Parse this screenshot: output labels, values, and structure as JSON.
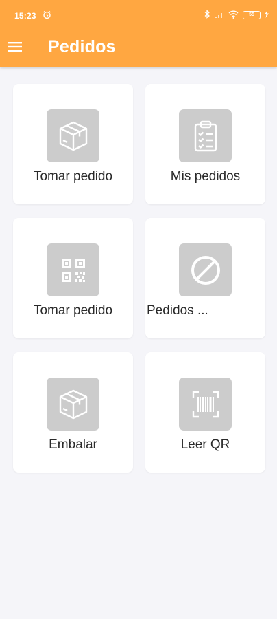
{
  "status_bar": {
    "time": "15:23",
    "battery": "55"
  },
  "header": {
    "title": "Pedidos",
    "background": "#ffa741"
  },
  "cards": [
    {
      "label": "Tomar pedido",
      "icon": "box-icon"
    },
    {
      "label": "Mis pedidos",
      "icon": "clipboard-list-icon"
    },
    {
      "label": "Tomar pedido",
      "icon": "qr-code-icon"
    },
    {
      "label": "Pedidos ...",
      "icon": "prohibited-icon"
    },
    {
      "label": "Embalar",
      "icon": "box-icon"
    },
    {
      "label": "Leer QR",
      "icon": "barcode-scan-icon"
    }
  ]
}
